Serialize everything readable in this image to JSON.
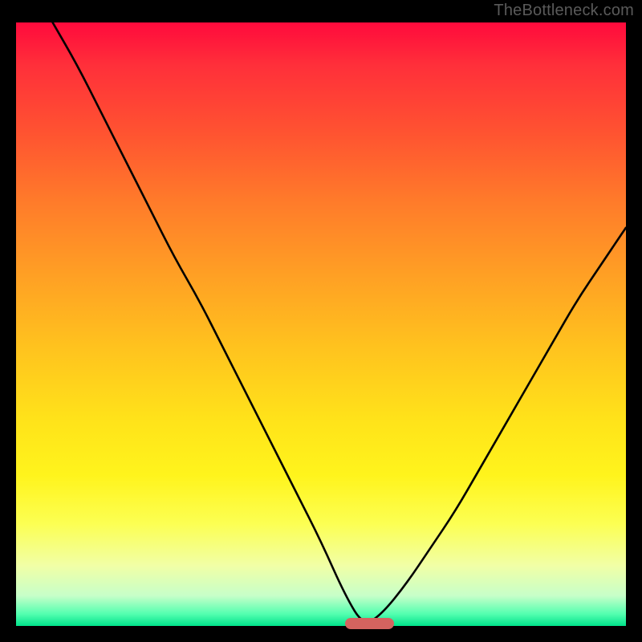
{
  "attribution": "TheBottleneck.com",
  "colors": {
    "frame_bg": "#000000",
    "curve": "#000000",
    "marker": "#d4635f",
    "gradient_stops": [
      "#ff0a3c",
      "#ff2f3a",
      "#ff5231",
      "#ff7c2a",
      "#ffa024",
      "#ffc31e",
      "#ffe31a",
      "#fff41c",
      "#fcff52",
      "#f1ffa6",
      "#c7ffc9",
      "#54ffb0",
      "#00e28a"
    ]
  },
  "chart_data": {
    "type": "line",
    "title": "",
    "xlabel": "",
    "ylabel": "",
    "xlim": [
      0,
      100
    ],
    "ylim": [
      0,
      100
    ],
    "notes": "V-shaped bottleneck curve; y axis is mismatch percentage (0 at bottom = ideal), minimum at x≈57. Values read from curve shape on a 0–100 virtual grid.",
    "marker": {
      "x_start": 54,
      "x_end": 62,
      "y": 0
    },
    "series": [
      {
        "name": "bottleneck-curve",
        "x": [
          6,
          10,
          14,
          18,
          22,
          26,
          30,
          34,
          38,
          42,
          46,
          50,
          54,
          57,
          60,
          64,
          68,
          72,
          76,
          80,
          84,
          88,
          92,
          96,
          100
        ],
        "values": [
          100,
          93,
          85,
          77,
          69,
          61,
          54,
          46,
          38,
          30,
          22,
          14,
          5,
          0,
          2,
          7,
          13,
          19,
          26,
          33,
          40,
          47,
          54,
          60,
          66
        ]
      }
    ]
  }
}
